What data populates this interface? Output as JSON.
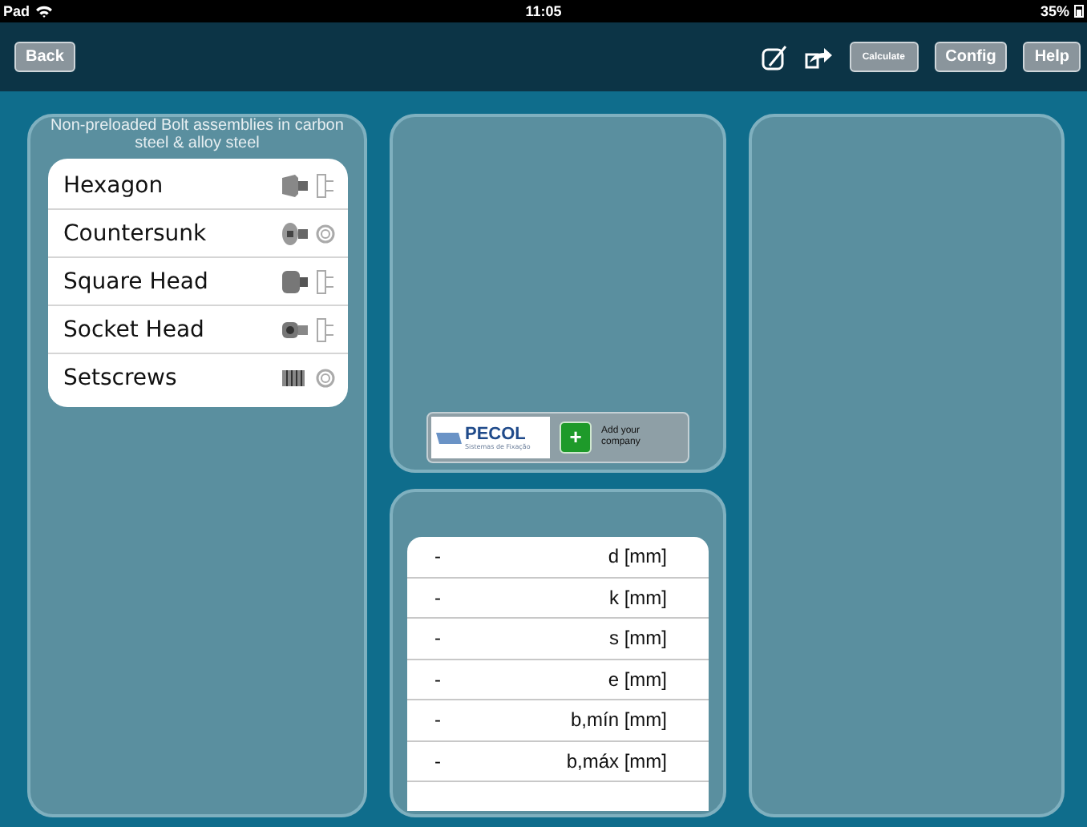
{
  "status_bar": {
    "device": "Pad",
    "time": "11:05",
    "battery": "35%"
  },
  "toolbar": {
    "back": "Back",
    "calculate": "Calculate",
    "config": "Config",
    "help": "Help"
  },
  "assemblies": {
    "title": "Non-preloaded Bolt assemblies in carbon steel & alloy steel",
    "items": [
      {
        "label": "Hexagon",
        "kind": "hexagon"
      },
      {
        "label": "Countersunk",
        "kind": "countersunk"
      },
      {
        "label": "Square Head",
        "kind": "square"
      },
      {
        "label": "Socket Head",
        "kind": "socket"
      },
      {
        "label": "Setscrews",
        "kind": "setscrew"
      }
    ]
  },
  "sponsor": {
    "logo": "PECOL",
    "logo_tagline": "Sistemas de Fixação",
    "add_button": "+",
    "add_label": "Add your company"
  },
  "dimensions": {
    "rows": [
      {
        "value": "-",
        "label": "d [mm]"
      },
      {
        "value": "-",
        "label": "k [mm]"
      },
      {
        "value": "-",
        "label": "s [mm]"
      },
      {
        "value": "-",
        "label": "e [mm]"
      },
      {
        "value": "-",
        "label": "b,mín [mm]"
      },
      {
        "value": "-",
        "label": "b,máx [mm]"
      }
    ]
  }
}
